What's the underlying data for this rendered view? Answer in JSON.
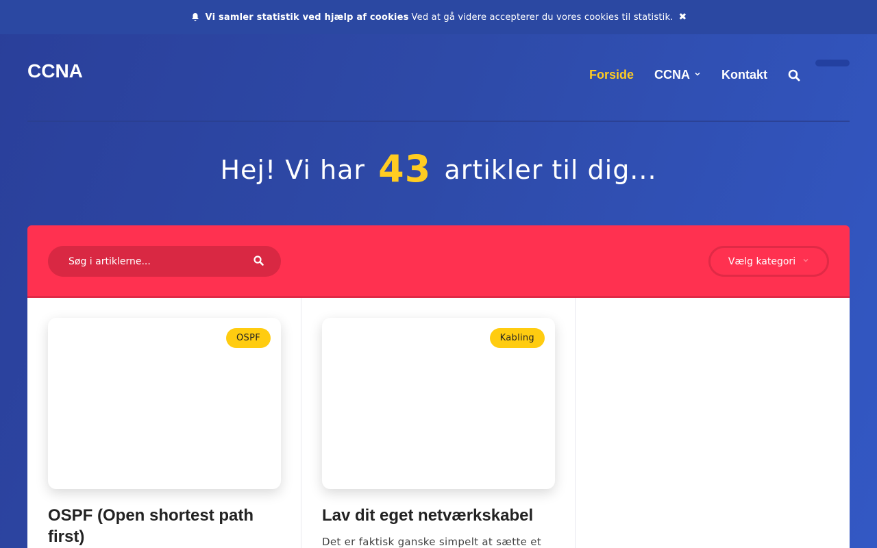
{
  "cookie": {
    "icon": "bell-icon",
    "bold": "Vi samler statistik ved hjælp af cookies",
    "text": "Ved at gå videre accepterer du vores cookies til statistik.",
    "close": "✖"
  },
  "site": {
    "logo": "CCNA"
  },
  "nav": {
    "items": [
      {
        "label": "Forside",
        "active": true
      },
      {
        "label": "CCNA",
        "has_dropdown": true
      },
      {
        "label": "Kontakt"
      }
    ],
    "chevron": "⌄"
  },
  "hero": {
    "before": "Hej! Vi har",
    "count": "43",
    "after": "artikler til dig..."
  },
  "search": {
    "placeholder": "Søg i artiklerne...",
    "category_label": "Vælg kategori",
    "chevron": "⌄"
  },
  "posts": [
    {
      "tag": "OSPF",
      "title": "OSPF (Open shortest path first)",
      "excerpt": ""
    },
    {
      "tag": "Kabling",
      "title": "Lav dit eget netværkskabel",
      "excerpt": "Det er faktisk ganske simpelt at sætte et"
    }
  ],
  "colors": {
    "accent_yellow": "#ffcc22",
    "panel_red": "#ff3150",
    "background_blue": "#2e4aa8"
  }
}
